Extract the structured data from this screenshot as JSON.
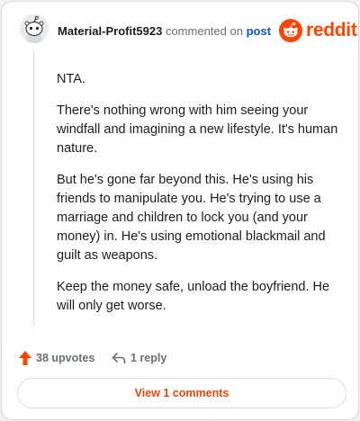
{
  "header": {
    "author": "Material-Profit5923",
    "commented_text": "commented on",
    "post_link": "post",
    "brand": "reddit"
  },
  "comment": {
    "paragraphs": [
      "NTA.",
      "There's nothing wrong with him seeing your windfall and imagining a new lifestyle. It's human nature.",
      "But he's gone far beyond this. He's using his friends to manipulate you. He's trying to use a marriage and children to lock you (and your money) in. He's using emotional blackmail and guilt as weapons.",
      "Keep the money safe, unload the boyfriend. He will only get worse."
    ]
  },
  "actions": {
    "upvotes": "38 upvotes",
    "reply": "1 reply",
    "upvote_icon": "upvote-arrow-icon",
    "reply_icon": "reply-arrow-icon"
  },
  "footer": {
    "view_comments": "View 1 comments"
  },
  "colors": {
    "brand": "#ff4500",
    "link": "#0a57c2",
    "view_button_text": "#e2480f"
  }
}
